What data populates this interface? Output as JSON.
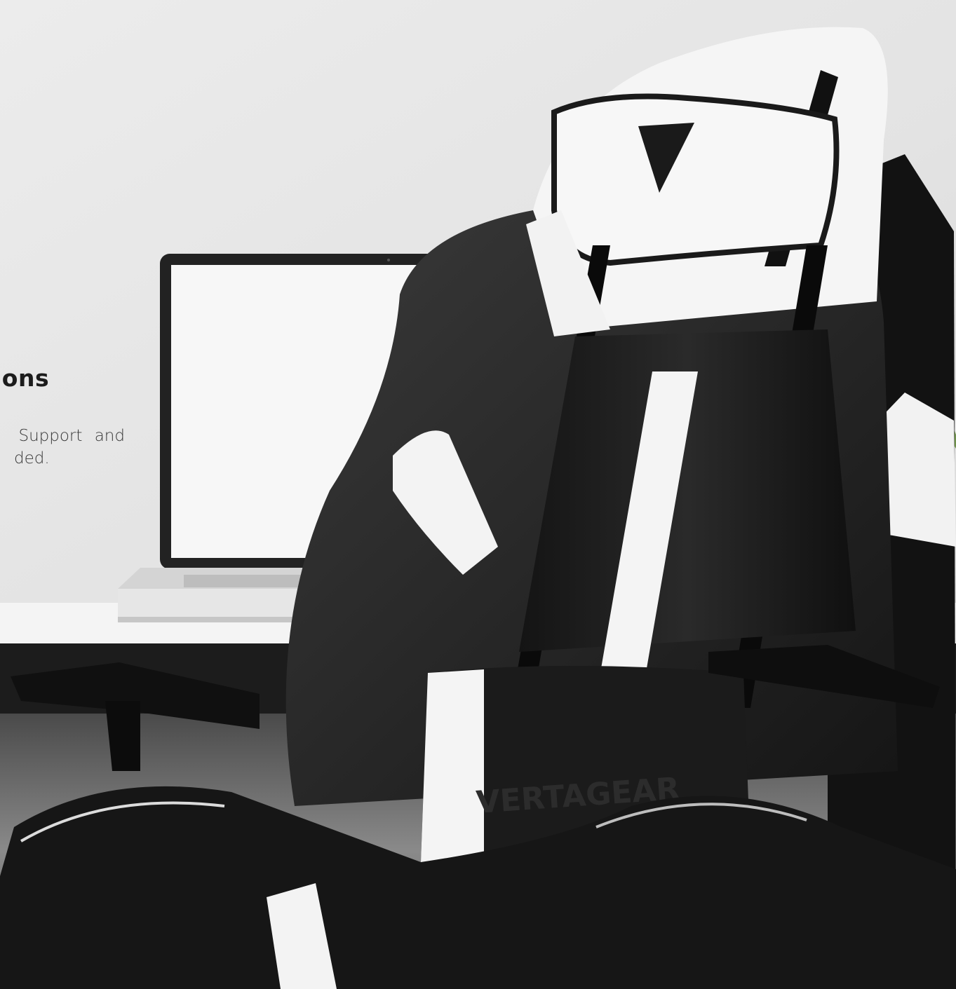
{
  "feature": {
    "heading": "ions",
    "description_lines": [
      "Support and",
      "ded."
    ]
  },
  "brand": {
    "logo": "vertagear-v-logo",
    "embossed_text": "VERTAGEAR"
  },
  "colors": {
    "wall": "#e9e9e9",
    "desk": "#f3f3f3",
    "chair_black": "#1a1a1a",
    "chair_white": "#f4f4f4",
    "floor": "#3a3a3a"
  }
}
